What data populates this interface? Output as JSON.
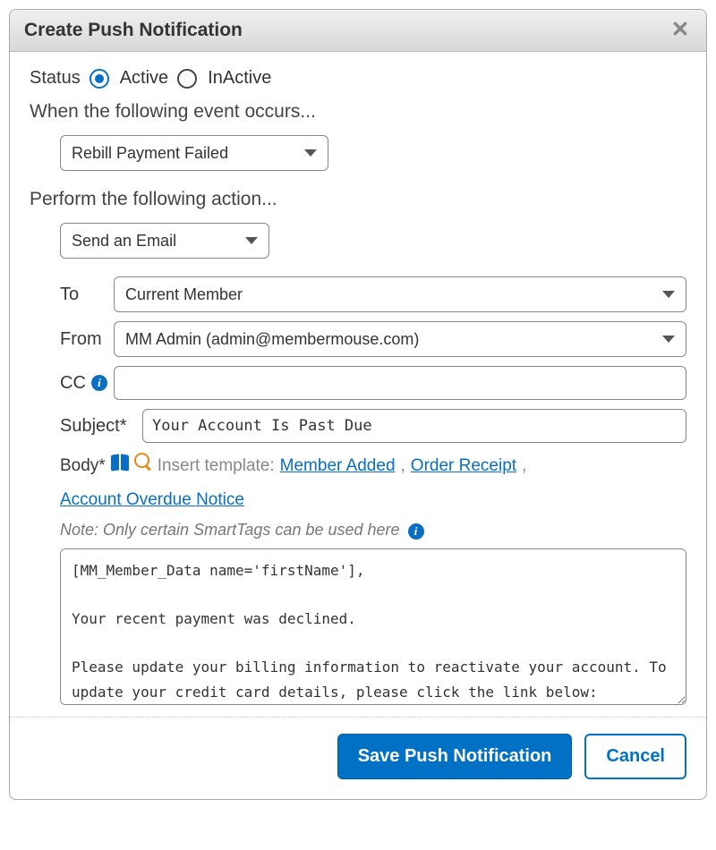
{
  "dialog": {
    "title": "Create Push Notification"
  },
  "status": {
    "label": "Status",
    "active_label": "Active",
    "inactive_label": "InActive",
    "selected": "active"
  },
  "event": {
    "heading": "When the following event occurs...",
    "selected": "Rebill Payment Failed"
  },
  "action": {
    "heading": "Perform the following action...",
    "selected": "Send an Email"
  },
  "email": {
    "to_label": "To",
    "to_value": "Current Member",
    "from_label": "From",
    "from_value": "MM Admin (admin@membermouse.com)",
    "cc_label": "CC",
    "cc_value": "",
    "subject_label": "Subject*",
    "subject_value": "Your Account Is Past Due",
    "body_label": "Body*",
    "insert_template_prefix": "Insert template:",
    "template_links": [
      "Member Added",
      "Order Receipt",
      "Account Overdue Notice"
    ],
    "note": "Note: Only certain SmartTags can be used here",
    "body_value": "[MM_Member_Data name='firstName'],\n\nYour recent payment was declined.\n\nPlease update your billing information to reactivate your account. To update your credit card details, please click the link below:"
  },
  "footer": {
    "save_label": "Save Push Notification",
    "cancel_label": "Cancel"
  }
}
